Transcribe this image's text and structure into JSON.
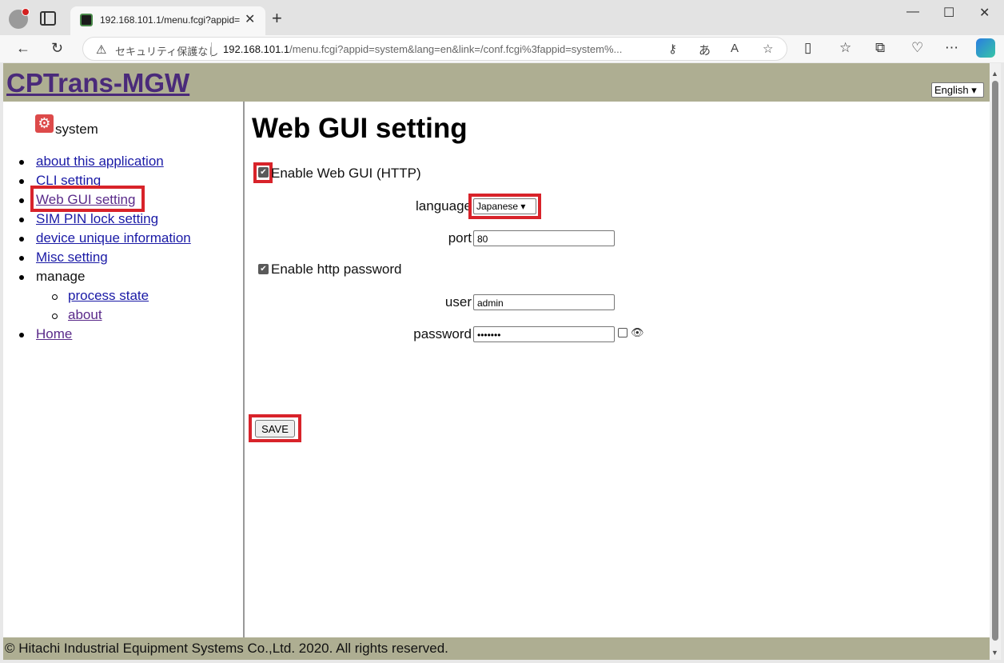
{
  "browser": {
    "tab_title": "192.168.101.1/menu.fcgi?appid=",
    "security_label": "セキュリティ保護なし",
    "url_host": "192.168.101.1",
    "url_path": "/menu.fcgi?appid=system&lang=en&link=/conf.fcgi%3fappid=system%..."
  },
  "header": {
    "logo": "CPTrans-MGW",
    "language_selected": "English"
  },
  "sidebar": {
    "section_label": "system",
    "items": [
      {
        "label": "about this application"
      },
      {
        "label": "CLI setting"
      },
      {
        "label": "Web GUI setting"
      },
      {
        "label": "SIM PIN lock setting"
      },
      {
        "label": "device unique information"
      },
      {
        "label": "Misc setting"
      },
      {
        "label": "manage"
      },
      {
        "label": "process state"
      },
      {
        "label": "about"
      },
      {
        "label": "Home"
      }
    ]
  },
  "main": {
    "title": "Web GUI setting",
    "enable_web_gui_label": "Enable Web GUI (HTTP)",
    "enable_web_gui_checked": true,
    "language_label": "language",
    "language_value": "Japanese",
    "port_label": "port",
    "port_value": "80",
    "enable_password_label": "Enable http password",
    "enable_password_checked": true,
    "user_label": "user",
    "user_value": "admin",
    "password_label": "password",
    "password_value": "•••••••",
    "save_label": "SAVE"
  },
  "footer": {
    "copyright": "© Hitachi Industrial Equipment Systems Co.,Ltd. 2020. All rights reserved."
  },
  "colors": {
    "header_bg": "#aeae92",
    "logo_color": "#4a2a7a",
    "highlight_red": "#d8232a",
    "link_blue": "#1a1aa6"
  }
}
